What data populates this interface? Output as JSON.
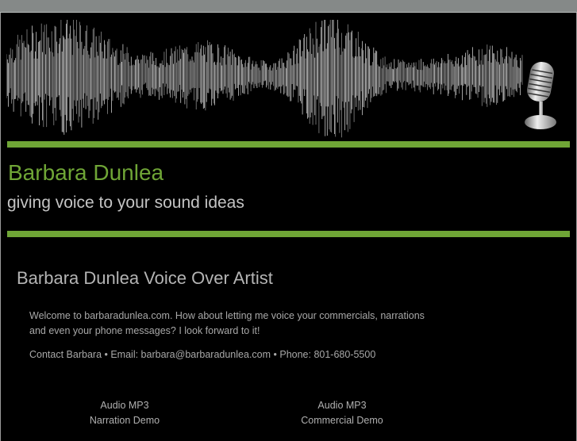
{
  "header": {
    "site_title": "Barbara Dunlea",
    "tagline": "giving voice to your sound ideas"
  },
  "main": {
    "heading": "Barbara Dunlea Voice Over Artist",
    "intro": "Welcome to barbaradunlea.com. How about letting me voice your commercials, narrations and even your phone messages? I look forward to it!",
    "contact": "Contact Barbara • Email: barbara@barbaradunlea.com • Phone: 801-680-5500",
    "demos": [
      {
        "line1": "Audio MP3",
        "line2": "Narration Demo"
      },
      {
        "line1": "Audio MP3",
        "line2": "Commercial Demo"
      }
    ]
  },
  "colors": {
    "accent": "#6fa536",
    "topbar": "#858988"
  }
}
